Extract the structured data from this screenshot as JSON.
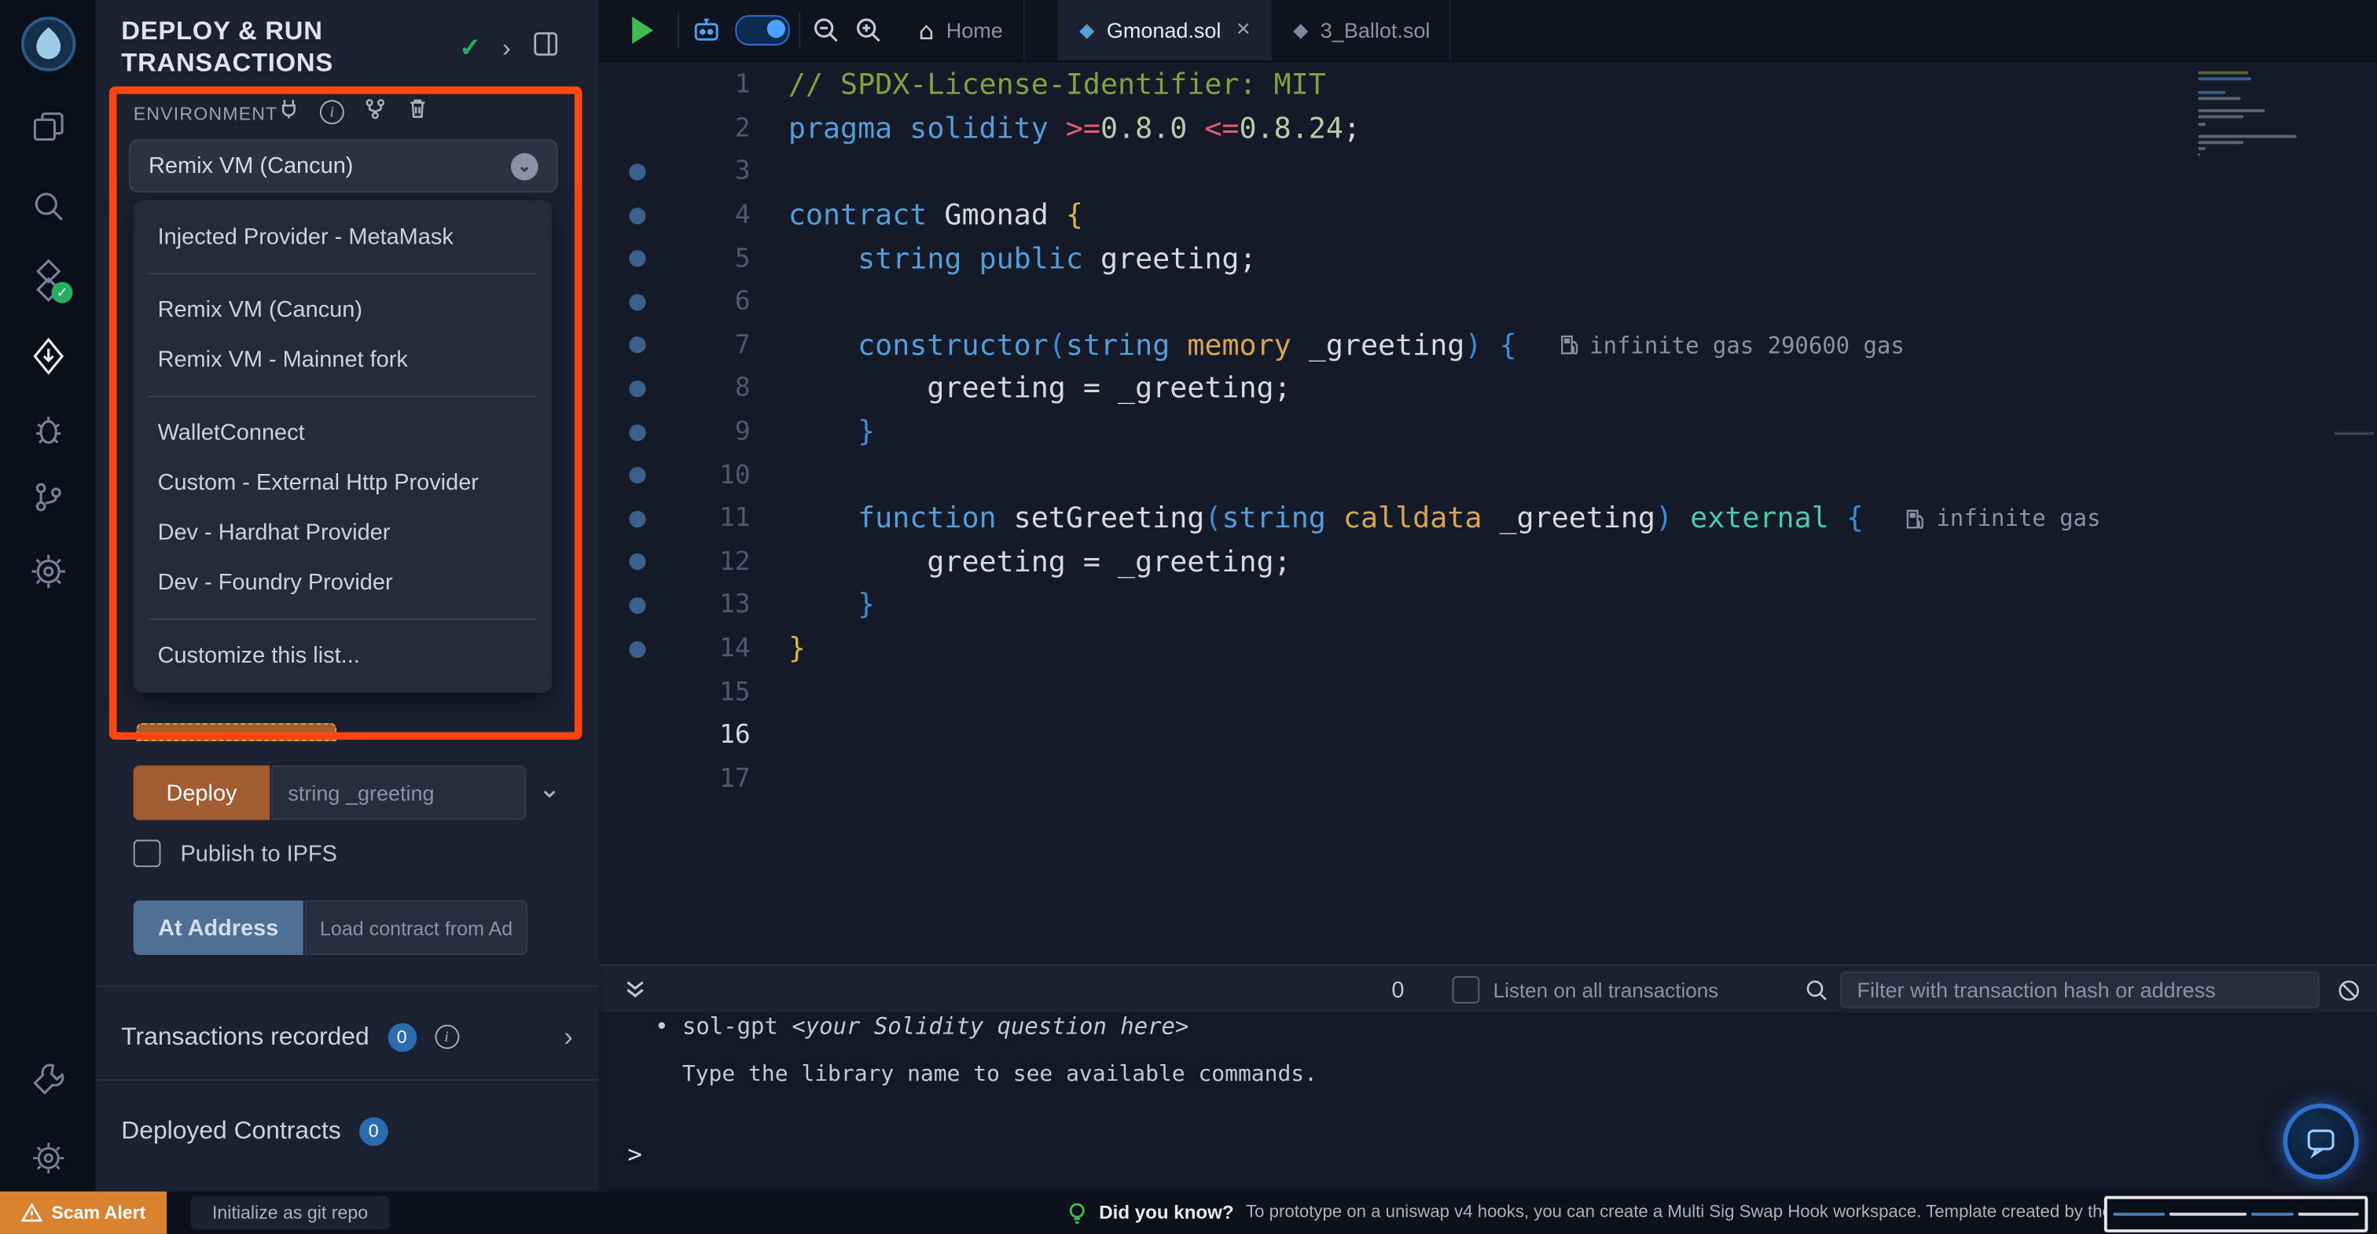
{
  "icons": {
    "check": "✓",
    "chevron_right": "›",
    "chevron_down": "⌄",
    "close": "×",
    "info": "i",
    "home": "⌂",
    "solidity": "◆",
    "bullet": "•"
  },
  "colors": {
    "highlight_frame": "#fb4612",
    "deploy_button": "#a15c32",
    "at_address_button": "#4f6f93",
    "badge_blue": "#2b6cb0",
    "play_green": "#3fb950",
    "success_green": "#27ae60",
    "scam_alert_bg": "#d9822f"
  },
  "panel": {
    "title": "DEPLOY & RUN TRANSACTIONS",
    "environment": {
      "label": "ENVIRONMENT",
      "selected": "Remix VM (Cancun)",
      "dropdown_items": [
        "Injected Provider - MetaMask",
        null,
        "Remix VM (Cancun)",
        "Remix VM - Mainnet fork",
        null,
        "WalletConnect",
        "Custom - External Http Provider",
        "Dev - Hardhat Provider",
        "Dev - Foundry Provider",
        null,
        "Customize this list..."
      ]
    },
    "deploy": {
      "button_label": "Deploy",
      "placeholder": "string _greeting"
    },
    "publish_label": "Publish to IPFS",
    "at_address": {
      "button_label": "At Address",
      "placeholder": "Load contract from Addre"
    },
    "transactions": {
      "label": "Transactions recorded",
      "count": "0"
    },
    "deployed": {
      "label": "Deployed Contracts",
      "count": "0"
    }
  },
  "tabs": {
    "home": "Home",
    "active": "Gmonad.sol",
    "secondary": "3_Ballot.sol"
  },
  "editor": {
    "lines": [
      {
        "n": 1,
        "tokens": [
          [
            "comment",
            "// SPDX-License-Identifier: MIT"
          ]
        ]
      },
      {
        "n": 2,
        "tokens": [
          [
            "kw",
            "pragma solidity "
          ],
          [
            "op",
            ">="
          ],
          [
            "num",
            "0.8.0 "
          ],
          [
            "op",
            "<="
          ],
          [
            "num",
            "0.8.24"
          ],
          [
            "plain",
            ";"
          ]
        ]
      },
      {
        "n": 3,
        "dot": true,
        "tokens": []
      },
      {
        "n": 4,
        "dot": true,
        "tokens": [
          [
            "kw",
            "contract "
          ],
          [
            "plain",
            "Gmonad "
          ],
          [
            "gold",
            "{"
          ]
        ]
      },
      {
        "n": 5,
        "dot": true,
        "tokens": [
          [
            "plain",
            "    "
          ],
          [
            "kw",
            "string "
          ],
          [
            "kw",
            "public "
          ],
          [
            "plain",
            "greeting;"
          ]
        ]
      },
      {
        "n": 6,
        "dot": true,
        "tokens": []
      },
      {
        "n": 7,
        "dot": true,
        "tokens": [
          [
            "plain",
            "    "
          ],
          [
            "kw",
            "constructor"
          ],
          [
            "pblue",
            "("
          ],
          [
            "kw",
            "string "
          ],
          [
            "storage",
            "memory "
          ],
          [
            "plain",
            "_greeting"
          ],
          [
            "pblue",
            ")"
          ],
          [
            "plain",
            " "
          ],
          [
            "pblue",
            "{"
          ]
        ],
        "gas": "infinite gas 290600 gas"
      },
      {
        "n": 8,
        "dot": true,
        "tokens": [
          [
            "plain",
            "        greeting = _greeting;"
          ]
        ]
      },
      {
        "n": 9,
        "dot": true,
        "tokens": [
          [
            "plain",
            "    "
          ],
          [
            "pblue",
            "}"
          ]
        ]
      },
      {
        "n": 10,
        "dot": true,
        "tokens": []
      },
      {
        "n": 11,
        "dot": true,
        "tokens": [
          [
            "plain",
            "    "
          ],
          [
            "kw",
            "function "
          ],
          [
            "plain",
            "setGreeting"
          ],
          [
            "pblue",
            "("
          ],
          [
            "kw",
            "string "
          ],
          [
            "storage",
            "calldata "
          ],
          [
            "plain",
            "_greeting"
          ],
          [
            "pblue",
            ")"
          ],
          [
            "plain",
            " "
          ],
          [
            "teal",
            "external "
          ],
          [
            "pblue",
            "{"
          ]
        ],
        "gas": "infinite gas"
      },
      {
        "n": 12,
        "dot": true,
        "tokens": [
          [
            "plain",
            "        greeting = _greeting;"
          ]
        ]
      },
      {
        "n": 13,
        "dot": true,
        "tokens": [
          [
            "plain",
            "    "
          ],
          [
            "pblue",
            "}"
          ]
        ]
      },
      {
        "n": 14,
        "dot": true,
        "tokens": [
          [
            "gold",
            "}"
          ]
        ]
      },
      {
        "n": 15,
        "tokens": []
      },
      {
        "n": 16,
        "current": true,
        "tokens": []
      },
      {
        "n": 17,
        "tokens": []
      }
    ]
  },
  "terminal": {
    "count": "0",
    "listen_label": "Listen on all transactions",
    "filter_placeholder": "Filter with transaction hash or address",
    "line1_bullet": "•",
    "line1_cmd": "sol-gpt ",
    "line1_hint": "<your Solidity question here>",
    "line2": "Type the library name to see available commands.",
    "prompt": ">"
  },
  "status_bar": {
    "scam_alert": "Scam Alert",
    "git_init": "Initialize as git repo",
    "tip_title": "Did you know?",
    "tip_text": "To prototype on a uniswap v4 hooks, you can create a Multi Sig Swap Hook workspace. Template created by the cookbook team."
  }
}
